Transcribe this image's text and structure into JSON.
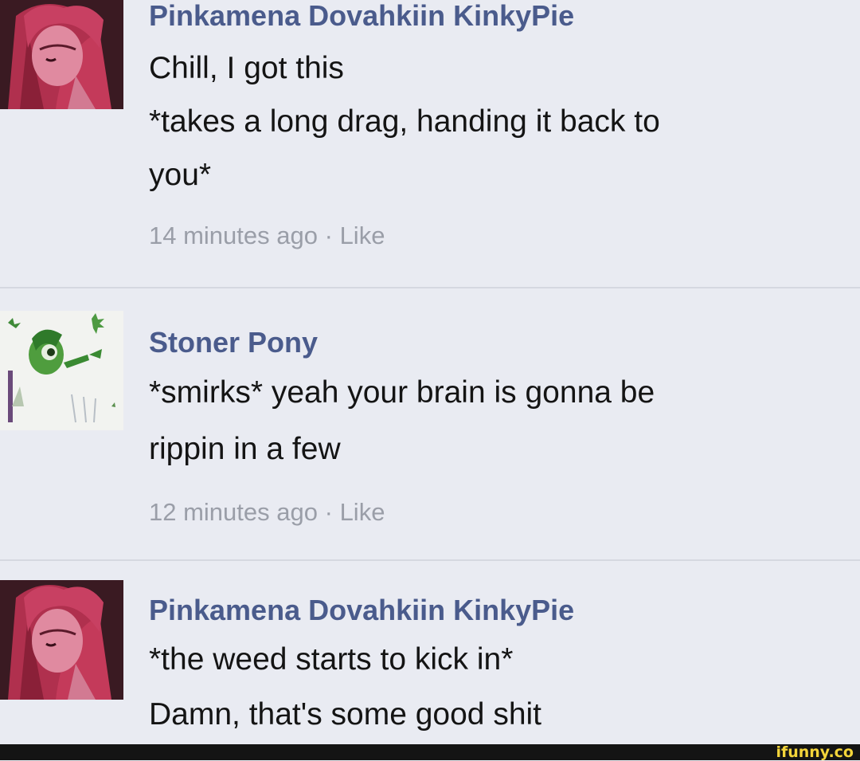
{
  "comments": [
    {
      "author": "Pinkamena Dovahkiin KinkyPie",
      "lines": [
        "Chill, I got this",
        "*takes a long drag, handing it back to",
        "you*"
      ],
      "time": "14 minutes ago",
      "separator": "·",
      "like_label": "Like",
      "avatar_icon": "pink-pony-avatar-icon"
    },
    {
      "author": "Stoner Pony",
      "lines": [
        "*smirks* yeah your brain is gonna be",
        "rippin in a few"
      ],
      "time": "12 minutes ago",
      "separator": "·",
      "like_label": "Like",
      "avatar_icon": "green-pony-avatar-icon"
    },
    {
      "author": "Pinkamena Dovahkiin KinkyPie",
      "lines": [
        "*the weed starts to kick in*",
        "Damn, that's some good shit"
      ],
      "avatar_icon": "pink-pony-avatar-icon"
    }
  ],
  "watermark": "ifunny.co",
  "colors": {
    "background": "#e9ebf2",
    "author": "#4a5b8c",
    "text": "#141414",
    "meta": "#9a9ea8",
    "watermark": "#f3d43a"
  }
}
